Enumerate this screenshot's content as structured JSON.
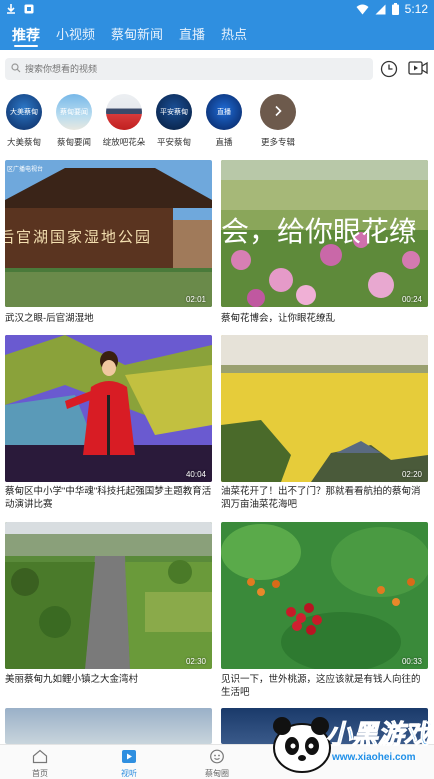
{
  "status_bar": {
    "time": "5:12"
  },
  "top_tabs": [
    {
      "label": "推荐"
    },
    {
      "label": "小视频"
    },
    {
      "label": "蔡甸新闻"
    },
    {
      "label": "直播"
    },
    {
      "label": "热点"
    }
  ],
  "search": {
    "placeholder": "搜索你想看的视频"
  },
  "channels": [
    {
      "label": "大美蔡甸",
      "badge": "大美蔡甸"
    },
    {
      "label": "蔡甸要闻",
      "badge": "蔡甸要闻"
    },
    {
      "label": "绽放吧花朵",
      "badge": ""
    },
    {
      "label": "平安蔡甸",
      "badge": "平安蔡甸"
    },
    {
      "label": "直播",
      "badge": "直播"
    },
    {
      "label": "更多专辑",
      "badge": ""
    }
  ],
  "videos": [
    {
      "title": "武汉之眼-后官湖湿地",
      "duration": "02:01",
      "overlay_text": "后官湖国家湿地公园",
      "corner_text": "区广播电视台"
    },
    {
      "title": "蔡甸花博会，让你眼花缭乱",
      "duration": "00:24",
      "overlay_text": "会，给你眼花缭"
    },
    {
      "title": "蔡甸区中小学\"中华魂\"科技托起强国梦主题教育活动演讲比赛",
      "duration": "40:04"
    },
    {
      "title": "油菜花开了！出不了门？那就看看航拍的蔡甸消泗万亩油菜花海吧",
      "duration": "02:20"
    },
    {
      "title": "美丽蔡甸九如鲤小镇之大金湾村",
      "duration": "02:30"
    },
    {
      "title": "见识一下，世外桃源，这应该就是有钱人向往的生活吧",
      "duration": "00:33"
    }
  ],
  "bottom_nav": [
    {
      "label": "首页"
    },
    {
      "label": "视听"
    },
    {
      "label": "蔡甸圈"
    }
  ],
  "watermark": {
    "brand": "小黑游戏",
    "url": "www.xiaohei.com"
  },
  "colors": {
    "primary": "#2f8fe0"
  }
}
